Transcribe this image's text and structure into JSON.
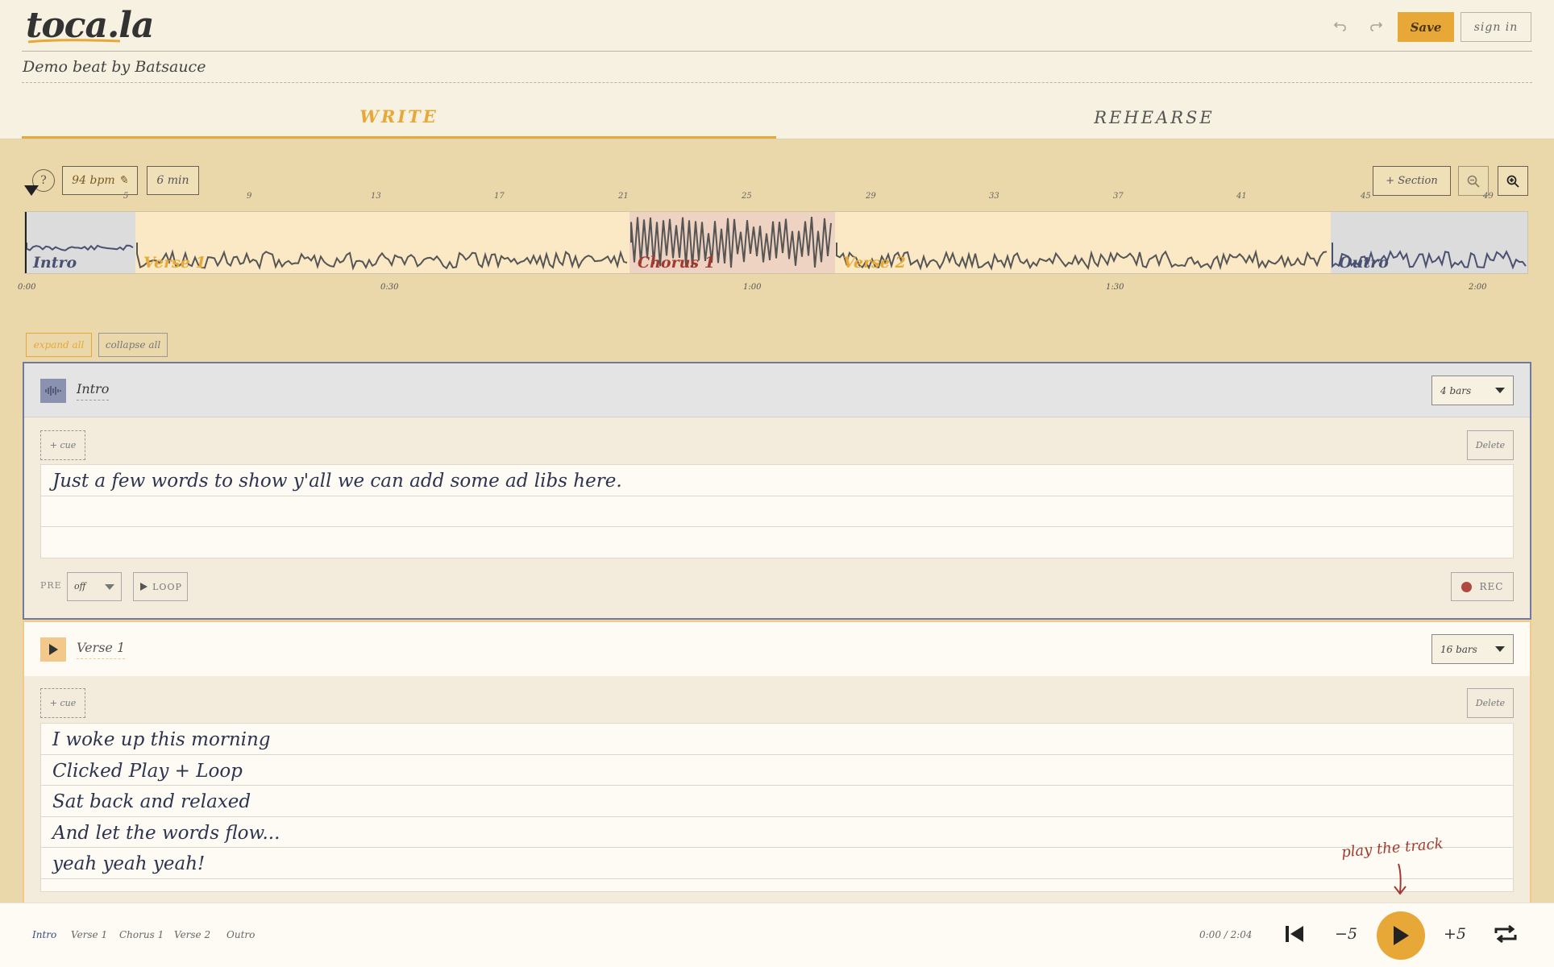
{
  "app": {
    "logo": "toca.la",
    "subtitle": "Demo beat by Batsauce"
  },
  "header": {
    "save_label": "Save",
    "signin_label": "sign in",
    "undo_icon": "undo-icon",
    "redo_icon": "redo-icon"
  },
  "tabs": [
    {
      "label": "WRITE",
      "active": true
    },
    {
      "label": "REHEARSE",
      "active": false
    }
  ],
  "toolbar": {
    "help": "?",
    "bpm": "94 bpm ✎",
    "duration": "6 min",
    "add_section": "+ Section"
  },
  "timeline": {
    "bar_numbers": [
      "5",
      "9",
      "13",
      "17",
      "21",
      "25",
      "29",
      "33",
      "37",
      "41",
      "45",
      "49"
    ],
    "time_labels": [
      "0:00",
      "0:30",
      "1:00",
      "1:30",
      "2:00"
    ],
    "segments": [
      {
        "label": "Intro",
        "color": "#dcdcdc",
        "text_color": "#4a5070"
      },
      {
        "label": "Verse 1",
        "color": "#fbe8c5",
        "text_color": "#e8a838"
      },
      {
        "label": "Chorus 1",
        "color": "#efd3c2",
        "text_color": "#a13a30"
      },
      {
        "label": "Verse 2",
        "color": "#fbe8c5",
        "text_color": "#e8a838"
      },
      {
        "label": "Outro",
        "color": "#dcdcdc",
        "text_color": "#4a5070"
      }
    ]
  },
  "controls": {
    "expand_all": "expand all",
    "collapse_all": "collapse all"
  },
  "sections": [
    {
      "name": "Intro",
      "bars": "4 bars",
      "cue": "+ cue",
      "delete": "Delete",
      "lyrics": [
        "Just a few words to show y'all we can add some ad libs here.",
        "",
        ""
      ],
      "pre_label": "PRE",
      "pre_value": "off",
      "loop": "LOOP",
      "rec": "REC"
    },
    {
      "name": "Verse 1",
      "bars": "16 bars",
      "cue": "+ cue",
      "delete": "Delete",
      "lyrics": [
        "I woke up this morning",
        "Clicked Play + Loop",
        "Sat back and relaxed",
        "And let the words flow...",
        "yeah yeah yeah!"
      ]
    }
  ],
  "hint": "play the track",
  "footer": {
    "sections": [
      "Intro",
      "Verse 1",
      "Chorus 1",
      "Verse 2",
      "Outro"
    ],
    "time": "0:00 / 2:04",
    "back5": "−5",
    "fwd5": "+5"
  },
  "colors": {
    "accent": "#e8a838",
    "rec": "#b04a40",
    "ink": "#2c3450"
  }
}
